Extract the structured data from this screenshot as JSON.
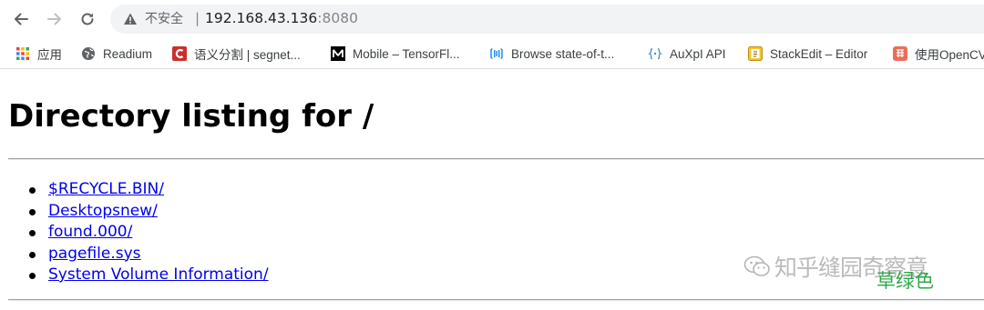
{
  "browser": {
    "address_bar": {
      "security_label": "不安全",
      "separator": "|",
      "host": "192.168.43.136",
      "port": ":8080"
    },
    "bookmarks": [
      {
        "label": "应用",
        "icon": "apps-grid-icon"
      },
      {
        "label": "Readium",
        "icon": "globe-icon"
      },
      {
        "label": "语义分割 | segnet...",
        "icon": "csdn-icon"
      },
      {
        "label": "Mobile – TensorFl...",
        "icon": "medium-icon"
      },
      {
        "label": "Browse state-of-t...",
        "icon": "paperswithcode-icon"
      },
      {
        "label": "AuXpI API",
        "icon": "api-braces-icon"
      },
      {
        "label": "StackEdit – Editor",
        "icon": "stackedit-icon"
      },
      {
        "label": "使用OpenCV",
        "icon": "jianshu-icon"
      }
    ]
  },
  "page": {
    "title": "Directory listing for /",
    "entries": [
      "$RECYCLE.BIN/",
      "Desktopsnew/",
      "found.000/",
      "pagefile.sys",
      "System Volume Information/"
    ]
  },
  "watermark": {
    "text": "知乎缝园奇察意",
    "brand": "草绿色"
  },
  "colors": {
    "link": "#0000ee",
    "omnibox_bg": "#f1f3f4",
    "watermark_green": "#2ea84a"
  }
}
